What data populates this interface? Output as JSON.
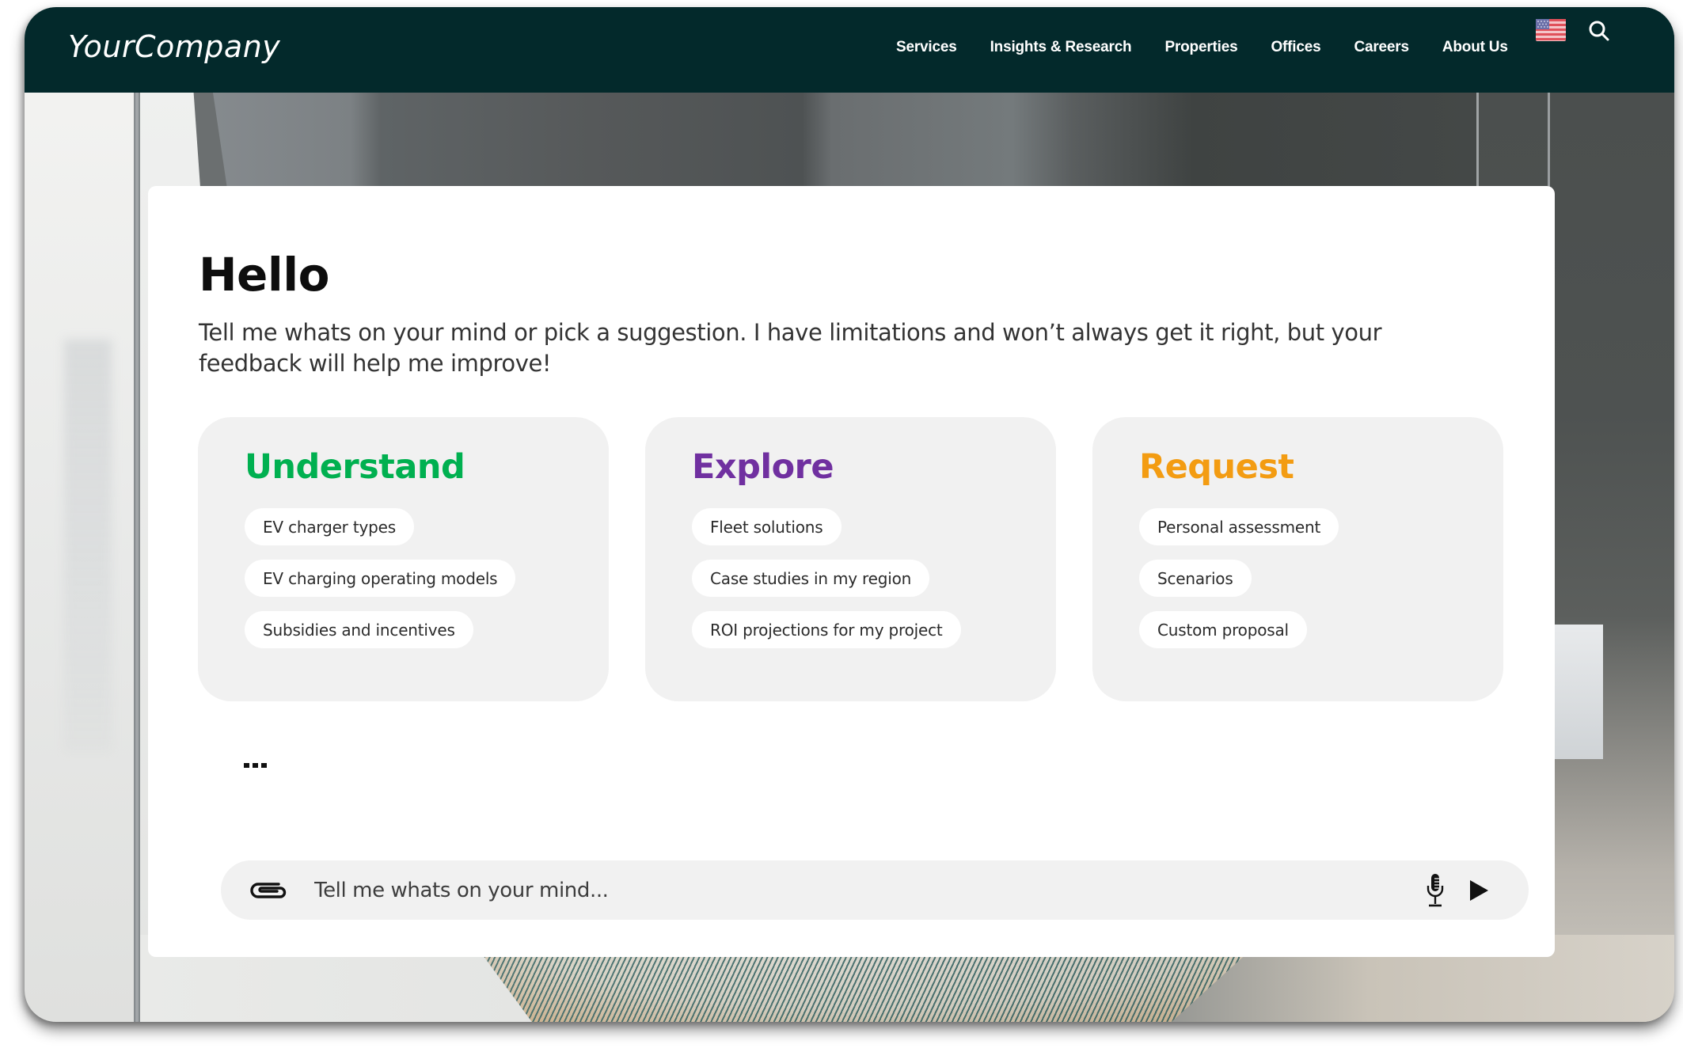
{
  "header": {
    "logo": "YourCompany",
    "nav": [
      {
        "label": "Services"
      },
      {
        "label": "Insights & Research"
      },
      {
        "label": "Properties"
      },
      {
        "label": "Offices"
      },
      {
        "label": "Careers"
      },
      {
        "label": "About Us"
      }
    ],
    "language_icon": "us-flag-icon",
    "search_icon": "search-icon",
    "background_color": "#03292b"
  },
  "chat": {
    "greeting": "Hello",
    "intro": "Tell me whats on your mind or pick a suggestion. I have limitations and won’t always get it right, but your feedback will help me improve!",
    "suggestion_groups": [
      {
        "title": "Understand",
        "color": "#00b050",
        "items": [
          "EV charger types",
          "EV charging operating models",
          "Subsidies and incentives"
        ]
      },
      {
        "title": "Explore",
        "color": "#7030a0",
        "items": [
          "Fleet solutions",
          "Case studies in my region",
          "ROI projections for my project"
        ]
      },
      {
        "title": "Request",
        "color": "#f39c12",
        "items": [
          "Personal assessment",
          "Scenarios",
          "Custom proposal"
        ]
      }
    ],
    "typing_indicator": "...",
    "input": {
      "value": "",
      "placeholder": "Tell me whats on your mind...",
      "attach_icon": "paperclip-icon",
      "mic_icon": "microphone-icon",
      "send_icon": "send-icon"
    }
  }
}
